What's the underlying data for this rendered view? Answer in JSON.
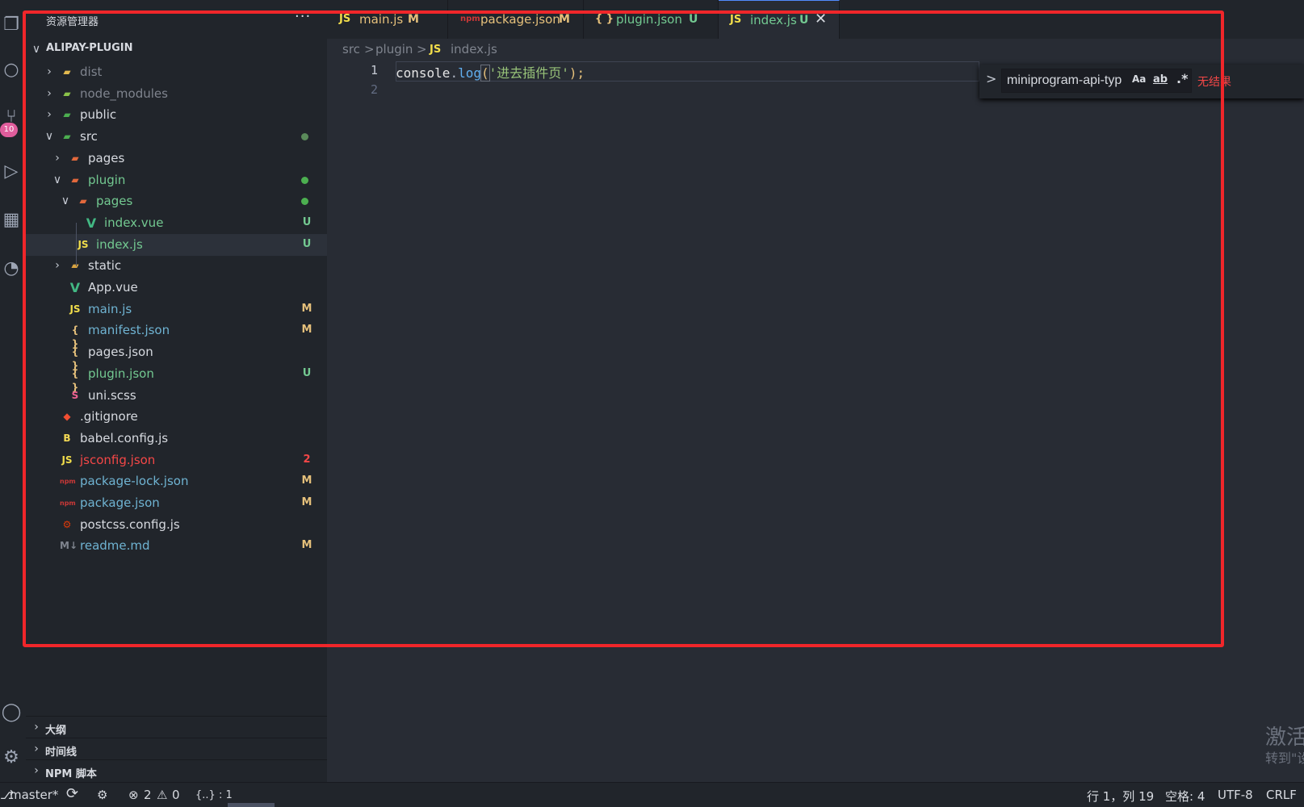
{
  "colors": {
    "accent": "#528bff",
    "modified": "#e5c07b",
    "untracked": "#73c991",
    "error": "#f44747",
    "folder": "#e2b94f",
    "vue": "#42b883",
    "js": "#f1dd4b",
    "red_annotation": "#f0262a"
  },
  "explorer": {
    "title": "资源管理器",
    "more_label": "···",
    "root": "ALIPAY-PLUGIN",
    "items": [
      {
        "label": "dist",
        "icon": "folder-dist-icon",
        "chev": ">",
        "badge": "",
        "dot": ""
      },
      {
        "label": "node_modules",
        "icon": "folder-node-icon",
        "chev": ">",
        "badge": "",
        "dot": ""
      },
      {
        "label": "public",
        "icon": "folder-public-icon",
        "chev": ">",
        "badge": "",
        "dot": ""
      },
      {
        "label": "src",
        "icon": "folder-src-icon",
        "chev": "∨",
        "badge": "",
        "dot": "#5a8a5a"
      },
      {
        "label": "pages",
        "icon": "folder-pages-icon",
        "chev": ">",
        "badge": "",
        "dot": ""
      },
      {
        "label": "plugin",
        "icon": "folder-plugin-icon",
        "chev": "∨",
        "badge": "",
        "dot": "#4caf50"
      },
      {
        "label": "pages",
        "icon": "folder-pages-icon",
        "chev": "∨",
        "badge": "",
        "dot": "#4caf50"
      },
      {
        "label": "index.vue",
        "icon": "vue-file-icon",
        "chev": "",
        "badge": "U",
        "dot": ""
      },
      {
        "label": "index.js",
        "icon": "js-file-icon",
        "chev": "",
        "badge": "U",
        "dot": ""
      },
      {
        "label": "static",
        "icon": "folder-static-icon",
        "chev": ">",
        "badge": "",
        "dot": ""
      },
      {
        "label": "App.vue",
        "icon": "vue-file-icon",
        "chev": "",
        "badge": "",
        "dot": ""
      },
      {
        "label": "main.js",
        "icon": "js-file-icon",
        "chev": "",
        "badge": "M",
        "dot": ""
      },
      {
        "label": "manifest.json",
        "icon": "json-file-icon",
        "chev": "",
        "badge": "M",
        "dot": ""
      },
      {
        "label": "pages.json",
        "icon": "json-file-icon",
        "chev": "",
        "badge": "",
        "dot": ""
      },
      {
        "label": "plugin.json",
        "icon": "json-file-icon",
        "chev": "",
        "badge": "U",
        "dot": ""
      },
      {
        "label": "uni.scss",
        "icon": "scss-file-icon",
        "chev": "",
        "badge": "",
        "dot": ""
      },
      {
        "label": ".gitignore",
        "icon": "git-file-icon",
        "chev": "",
        "badge": "",
        "dot": ""
      },
      {
        "label": "babel.config.js",
        "icon": "babel-file-icon",
        "chev": "",
        "badge": "",
        "dot": ""
      },
      {
        "label": "jsconfig.json",
        "icon": "jsconfig-file-icon",
        "chev": "",
        "badge": "2",
        "dot": ""
      },
      {
        "label": "package-lock.json",
        "icon": "npm-file-icon",
        "chev": "",
        "badge": "M",
        "dot": ""
      },
      {
        "label": "package.json",
        "icon": "npm-file-icon",
        "chev": "",
        "badge": "M",
        "dot": ""
      },
      {
        "label": "postcss.config.js",
        "icon": "postcss-file-icon",
        "chev": "",
        "badge": "",
        "dot": ""
      },
      {
        "label": "readme.md",
        "icon": "markdown-file-icon",
        "chev": "",
        "badge": "M",
        "dot": ""
      }
    ],
    "panels": [
      "大纲",
      "时间线",
      "NPM 脚本"
    ]
  },
  "activity": {
    "scm_badge": "10",
    "icons": [
      "files-icon",
      "search-icon",
      "source-control-icon",
      "run-debug-icon",
      "extensions-icon",
      "git-graph-icon",
      "account-icon",
      "settings-gear-icon"
    ]
  },
  "tabs": [
    {
      "icon": "JS",
      "label": "main.js",
      "badge": "M"
    },
    {
      "icon": "npm",
      "label": "package.json",
      "badge": "M"
    },
    {
      "icon": "{ }",
      "label": "plugin.json",
      "badge": "U"
    },
    {
      "icon": "JS",
      "label": "index.js",
      "badge": "U",
      "close": "✕"
    }
  ],
  "breadcrumb": {
    "parts": [
      "src",
      "plugin"
    ],
    "file_icon": "JS",
    "file": "index.js",
    "sep": ">"
  },
  "editor": {
    "line_numbers": [
      "1",
      "2"
    ],
    "code": {
      "obj": "console",
      "dot": ".",
      "fn": "log",
      "open": "(",
      "str": "'进去插件页'",
      "close": ");"
    }
  },
  "find": {
    "toggle": ">",
    "value": "miniprogram-api-typ",
    "opt_case": "Aa",
    "opt_word": "ab",
    "opt_regex": ".*",
    "result": "无结果"
  },
  "watermark": {
    "line1": "激活",
    "line2": "转到\"设"
  },
  "status": {
    "branch": "master*",
    "branch_icon": "⎇",
    "sync_icon": "⟳",
    "graph_icon": "⚙",
    "errors": "2",
    "warnings": "0",
    "selection": "{..} : 1",
    "position": "行 1，列 19",
    "spaces": "空格: 4",
    "encoding": "UTF-8",
    "eol": "CRLF"
  }
}
